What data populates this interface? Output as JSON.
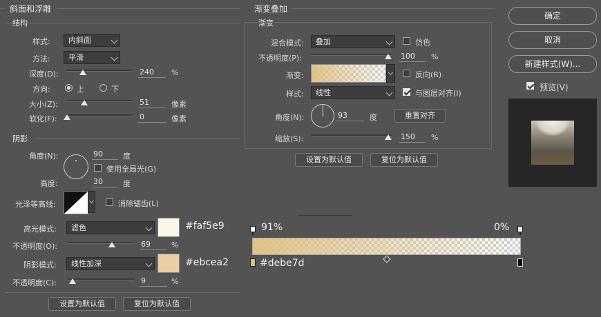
{
  "bevel": {
    "title": "斜面和浮雕",
    "structure": "结构",
    "style_label": "样式:",
    "style_value": "内斜面",
    "technique_label": "方法:",
    "technique_value": "平滑",
    "depth_label": "深度(D):",
    "depth_value": "240",
    "depth_unit": "%",
    "direction_label": "方向:",
    "dir_up": "上",
    "dir_down": "下",
    "size_label": "大小(Z):",
    "size_value": "51",
    "size_unit": "像素",
    "soften_label": "软化(F):",
    "soften_value": "0",
    "soften_unit": "像素"
  },
  "shading": {
    "title": "阴影",
    "angle_label": "角度(N):",
    "angle_value": "90",
    "angle_unit": "度",
    "global_light": "使用全局光(G)",
    "altitude_label": "高度:",
    "altitude_value": "30",
    "altitude_unit": "度",
    "gloss_label": "光泽等高线:",
    "antialias": "消除锯齿(L)",
    "highlight_label": "高光模式:",
    "highlight_mode": "滤色",
    "highlight_hex": "#faf5e9",
    "highlight_color": "#faf5e9",
    "highlight_opacity_label": "不透明度(O):",
    "highlight_opacity": "69",
    "shadow_label": "阴影模式:",
    "shadow_mode": "线性加深",
    "shadow_hex": "#ebcea2",
    "shadow_color": "#ebcea2",
    "shadow_opacity_label": "不透明度(C):",
    "shadow_opacity": "9",
    "pct": "%"
  },
  "left_buttons": {
    "default": "设置为默认值",
    "reset": "复位为默认值"
  },
  "overlay": {
    "title": "渐变叠加",
    "gradient_section": "渐变",
    "blend_label": "混合模式:",
    "blend_value": "叠加",
    "dither": "仿色",
    "opacity_label": "不透明度(P):",
    "opacity_value": "100",
    "gradient_label": "渐变:",
    "reverse": "反向(R)",
    "style_label": "样式:",
    "style_value": "线性",
    "align": "与图层对齐(I)",
    "angle_label": "角度(N):",
    "angle_value": "93",
    "angle_unit": "度",
    "reset_align": "重置对齐",
    "scale_label": "缩放(S):",
    "scale_value": "150",
    "pct": "%",
    "default_btn": "设置为默认值",
    "reset_btn": "复位为默认值"
  },
  "editor": {
    "left_stop": "91%",
    "right_stop": "0%",
    "color_stop_hex": "#debe7d",
    "gradient_color": "#debe7d"
  },
  "dialog": {
    "ok": "确定",
    "cancel": "取消",
    "new_style": "新建样式(W)...",
    "preview": "预览(V)"
  }
}
